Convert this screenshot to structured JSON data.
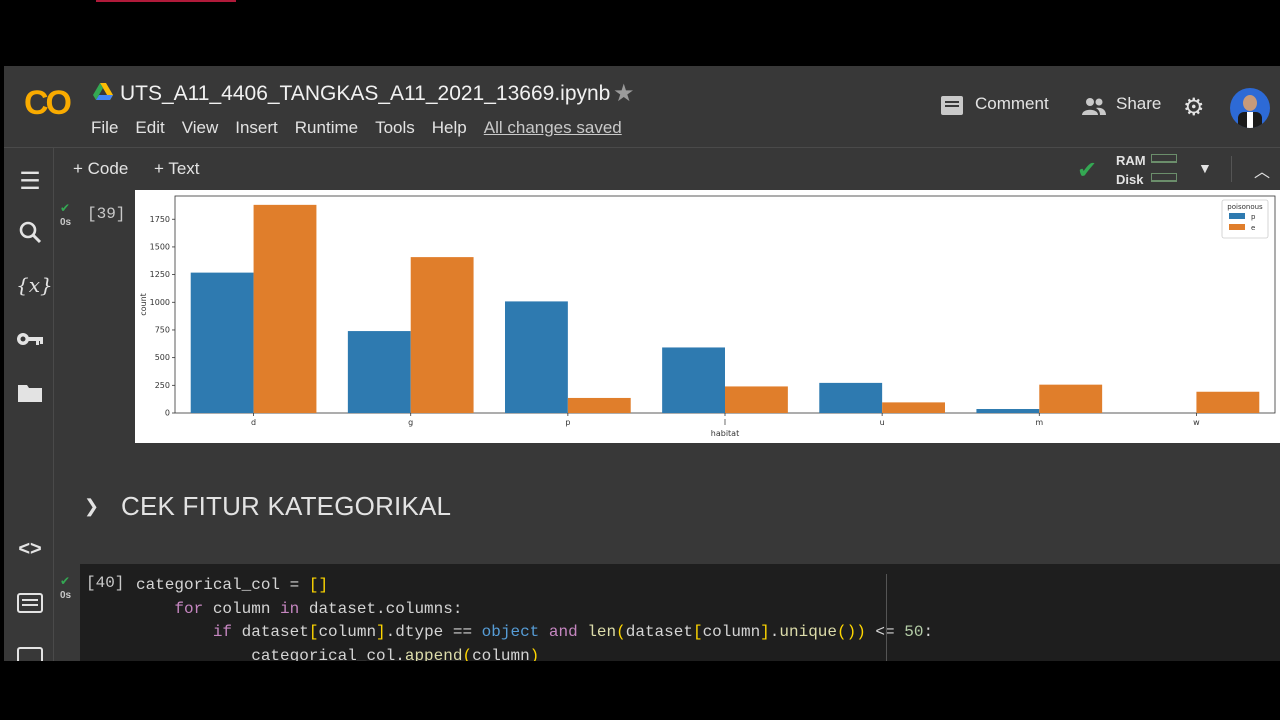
{
  "header": {
    "title": "UTS_A11_4406_TANGKAS_A11_2021_13669.ipynb",
    "logo": "CO",
    "menu": [
      "File",
      "Edit",
      "View",
      "Insert",
      "Runtime",
      "Tools",
      "Help"
    ],
    "saved_status": "All changes saved",
    "comment_label": "Comment",
    "share_label": "Share"
  },
  "toolbar": {
    "code_label": "+ Code",
    "text_label": "+ Text",
    "ram_label": "RAM",
    "disk_label": "Disk"
  },
  "cells": [
    {
      "exec_count": "[39]",
      "time": "0s"
    },
    {
      "exec_count": "[40]",
      "time": "0s"
    }
  ],
  "section": {
    "title": "CEK FITUR KATEGORIKAL"
  },
  "code_lines": [
    "categorical_col = []",
    "for column in dataset.columns:",
    "if dataset[column].dtype == object and len(dataset[column].unique()) <= 50:",
    "categorical_col.append(column)"
  ],
  "colors": {
    "p": "#2e7ab0",
    "e": "#e07e2b",
    "accent": "#f9ab00",
    "success": "#34a853"
  },
  "icons": [
    "drive-icon",
    "star-icon",
    "comment-icon",
    "share-icon",
    "gear-icon",
    "toc-icon",
    "search-icon",
    "variables-icon",
    "key-icon",
    "folder-icon",
    "code-snippets-icon",
    "terminal-icon"
  ],
  "chart_data": {
    "type": "bar",
    "categories": [
      "d",
      "g",
      "p",
      "l",
      "u",
      "m",
      "w"
    ],
    "series": [
      {
        "name": "p",
        "values": [
          1268,
          740,
          1008,
          592,
          272,
          36,
          0
        ]
      },
      {
        "name": "e",
        "values": [
          1880,
          1408,
          136,
          240,
          96,
          256,
          192
        ]
      }
    ],
    "title": "",
    "xlabel": "habitat",
    "ylabel": "count",
    "legend_title": "poisonous",
    "yticks": [
      0,
      250,
      500,
      750,
      1000,
      1250,
      1500,
      1750
    ],
    "ylim": [
      0,
      1960
    ],
    "legend_position": "top-right",
    "grid": false
  }
}
